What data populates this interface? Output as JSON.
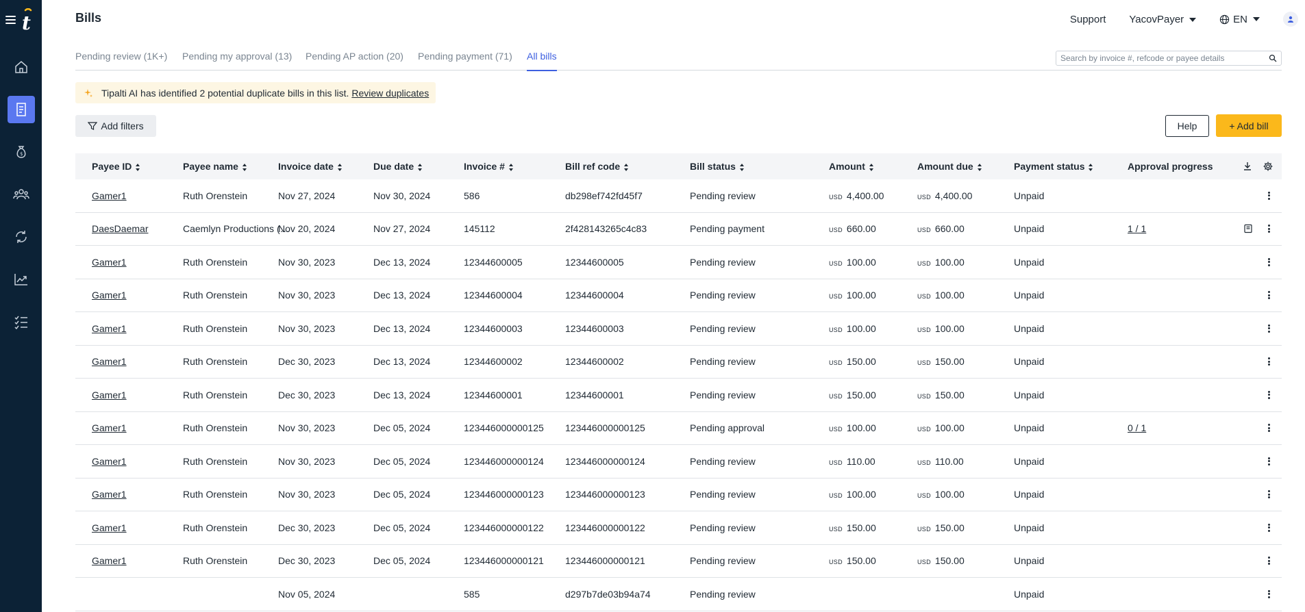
{
  "header": {
    "title": "Bills",
    "support": "Support",
    "user": "YacovPayer",
    "language": "EN"
  },
  "tabs": [
    {
      "label": "Pending review (1K+)"
    },
    {
      "label": "Pending my approval (13)"
    },
    {
      "label": "Pending AP action (20)"
    },
    {
      "label": "Pending payment (71)"
    },
    {
      "label": "All bills"
    }
  ],
  "search": {
    "placeholder": "Search by invoice #, refcode or payee details"
  },
  "banner": {
    "text": "Tipalti AI has identified 2 potential duplicate bills in this list.",
    "link": "Review duplicates"
  },
  "toolbar": {
    "filters": "Add filters",
    "help": "Help",
    "add_bill": "+ Add bill"
  },
  "colors": {
    "sidebar": "#0c2236",
    "accent": "#5a78f0",
    "primary_button": "#fbb81b",
    "banner": "#fdf6e3"
  },
  "table": {
    "columns": [
      "Payee ID",
      "Payee name",
      "Invoice date",
      "Due date",
      "Invoice #",
      "Bill ref code",
      "Bill status",
      "Amount",
      "Amount due",
      "Payment status",
      "Approval progress"
    ],
    "rows": [
      {
        "payee_id": "Gamer1",
        "payee_name": "Ruth Orenstein",
        "invoice_date": "Nov 27, 2024",
        "due_date": "Nov 30, 2024",
        "invoice_no": "586",
        "ref": "db298ef742fd45f7",
        "status": "Pending review",
        "cur": "USD",
        "amount": "4,400.00",
        "cur_due": "USD",
        "amount_due": "4,400.00",
        "payment_status": "Unpaid",
        "approval": ""
      },
      {
        "payee_id": "DaesDaemar",
        "payee_name": "Caemlyn Productions (E...",
        "invoice_date": "Nov 20, 2024",
        "due_date": "Nov 27, 2024",
        "invoice_no": "145112",
        "ref": "2f428143265c4c83",
        "status": "Pending payment",
        "cur": "USD",
        "amount": "660.00",
        "cur_due": "USD",
        "amount_due": "660.00",
        "payment_status": "Unpaid",
        "approval": "1 / 1"
      },
      {
        "payee_id": "Gamer1",
        "payee_name": "Ruth Orenstein",
        "invoice_date": "Nov 30, 2023",
        "due_date": "Dec 13, 2024",
        "invoice_no": "12344600005",
        "ref": "12344600005",
        "status": "Pending review",
        "cur": "USD",
        "amount": "100.00",
        "cur_due": "USD",
        "amount_due": "100.00",
        "payment_status": "Unpaid",
        "approval": ""
      },
      {
        "payee_id": "Gamer1",
        "payee_name": "Ruth Orenstein",
        "invoice_date": "Nov 30, 2023",
        "due_date": "Dec 13, 2024",
        "invoice_no": "12344600004",
        "ref": "12344600004",
        "status": "Pending review",
        "cur": "USD",
        "amount": "100.00",
        "cur_due": "USD",
        "amount_due": "100.00",
        "payment_status": "Unpaid",
        "approval": ""
      },
      {
        "payee_id": "Gamer1",
        "payee_name": "Ruth Orenstein",
        "invoice_date": "Nov 30, 2023",
        "due_date": "Dec 13, 2024",
        "invoice_no": "12344600003",
        "ref": "12344600003",
        "status": "Pending review",
        "cur": "USD",
        "amount": "100.00",
        "cur_due": "USD",
        "amount_due": "100.00",
        "payment_status": "Unpaid",
        "approval": ""
      },
      {
        "payee_id": "Gamer1",
        "payee_name": "Ruth Orenstein",
        "invoice_date": "Dec 30, 2023",
        "due_date": "Dec 13, 2024",
        "invoice_no": "12344600002",
        "ref": "12344600002",
        "status": "Pending review",
        "cur": "USD",
        "amount": "150.00",
        "cur_due": "USD",
        "amount_due": "150.00",
        "payment_status": "Unpaid",
        "approval": ""
      },
      {
        "payee_id": "Gamer1",
        "payee_name": "Ruth Orenstein",
        "invoice_date": "Dec 30, 2023",
        "due_date": "Dec 13, 2024",
        "invoice_no": "12344600001",
        "ref": "12344600001",
        "status": "Pending review",
        "cur": "USD",
        "amount": "150.00",
        "cur_due": "USD",
        "amount_due": "150.00",
        "payment_status": "Unpaid",
        "approval": ""
      },
      {
        "payee_id": "Gamer1",
        "payee_name": "Ruth Orenstein",
        "invoice_date": "Nov 30, 2023",
        "due_date": "Dec 05, 2024",
        "invoice_no": "123446000000125",
        "ref": "123446000000125",
        "status": "Pending approval",
        "cur": "USD",
        "amount": "100.00",
        "cur_due": "USD",
        "amount_due": "100.00",
        "payment_status": "Unpaid",
        "approval": "0 / 1"
      },
      {
        "payee_id": "Gamer1",
        "payee_name": "Ruth Orenstein",
        "invoice_date": "Nov 30, 2023",
        "due_date": "Dec 05, 2024",
        "invoice_no": "123446000000124",
        "ref": "123446000000124",
        "status": "Pending review",
        "cur": "USD",
        "amount": "110.00",
        "cur_due": "USD",
        "amount_due": "110.00",
        "payment_status": "Unpaid",
        "approval": ""
      },
      {
        "payee_id": "Gamer1",
        "payee_name": "Ruth Orenstein",
        "invoice_date": "Nov 30, 2023",
        "due_date": "Dec 05, 2024",
        "invoice_no": "123446000000123",
        "ref": "123446000000123",
        "status": "Pending review",
        "cur": "USD",
        "amount": "100.00",
        "cur_due": "USD",
        "amount_due": "100.00",
        "payment_status": "Unpaid",
        "approval": ""
      },
      {
        "payee_id": "Gamer1",
        "payee_name": "Ruth Orenstein",
        "invoice_date": "Dec 30, 2023",
        "due_date": "Dec 05, 2024",
        "invoice_no": "123446000000122",
        "ref": "123446000000122",
        "status": "Pending review",
        "cur": "USD",
        "amount": "150.00",
        "cur_due": "USD",
        "amount_due": "150.00",
        "payment_status": "Unpaid",
        "approval": ""
      },
      {
        "payee_id": "Gamer1",
        "payee_name": "Ruth Orenstein",
        "invoice_date": "Dec 30, 2023",
        "due_date": "Dec 05, 2024",
        "invoice_no": "123446000000121",
        "ref": "123446000000121",
        "status": "Pending review",
        "cur": "USD",
        "amount": "150.00",
        "cur_due": "USD",
        "amount_due": "150.00",
        "payment_status": "Unpaid",
        "approval": ""
      },
      {
        "payee_id": "",
        "payee_name": "",
        "invoice_date": "Nov 05, 2024",
        "due_date": "",
        "invoice_no": "585",
        "ref": "d297b7de03b94a74",
        "status": "Pending review",
        "cur": "",
        "amount": "",
        "cur_due": "",
        "amount_due": "",
        "payment_status": "Unpaid",
        "approval": ""
      }
    ]
  }
}
